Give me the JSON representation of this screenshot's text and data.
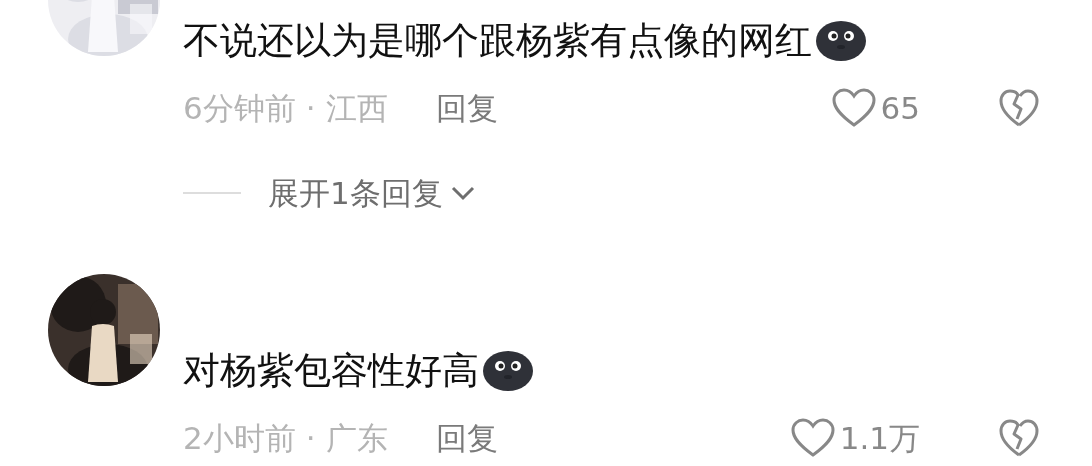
{
  "comments": [
    {
      "text": "不说还以为是哪个跟杨紫有点像的网红",
      "time": "6分钟前",
      "separator": "·",
      "location": "江西",
      "reply": "回复",
      "likes": "65",
      "expand": "展开1条回复"
    },
    {
      "text": "对杨紫包容性好高",
      "time": "2小时前",
      "separator": "·",
      "location": "广东",
      "reply": "回复",
      "likes": "1.1万"
    }
  ]
}
